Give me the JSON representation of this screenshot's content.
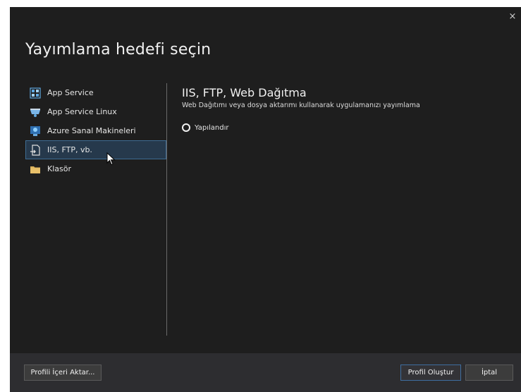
{
  "dialog": {
    "title": "Yayımlama hedefi seçin",
    "close_label": "×"
  },
  "sidebar": {
    "items": [
      {
        "label": "App Service",
        "icon": "app-service-icon"
      },
      {
        "label": "App Service Linux",
        "icon": "app-service-linux-icon"
      },
      {
        "label": "Azure Sanal Makineleri",
        "icon": "virtual-machine-icon"
      },
      {
        "label": "IIS, FTP, vb.",
        "icon": "deploy-icon",
        "selected": true
      },
      {
        "label": "Klasör",
        "icon": "folder-icon"
      }
    ]
  },
  "content": {
    "heading": "IIS, FTP, Web Dağıtma",
    "description": "Web Dağıtımı veya dosya aktarımı kullanarak uygulamanızı yayımlama",
    "option_label": "Yapılandır"
  },
  "footer": {
    "import_label": "Profili İçeri Aktar...",
    "create_label": "Profil Oluştur",
    "cancel_label": "İptal"
  },
  "colors": {
    "background": "#1e1e1e",
    "footer": "#2d2d30",
    "selected_bg": "#26394c",
    "selected_border": "#3e6c93",
    "accent": "#3f6ea0"
  }
}
